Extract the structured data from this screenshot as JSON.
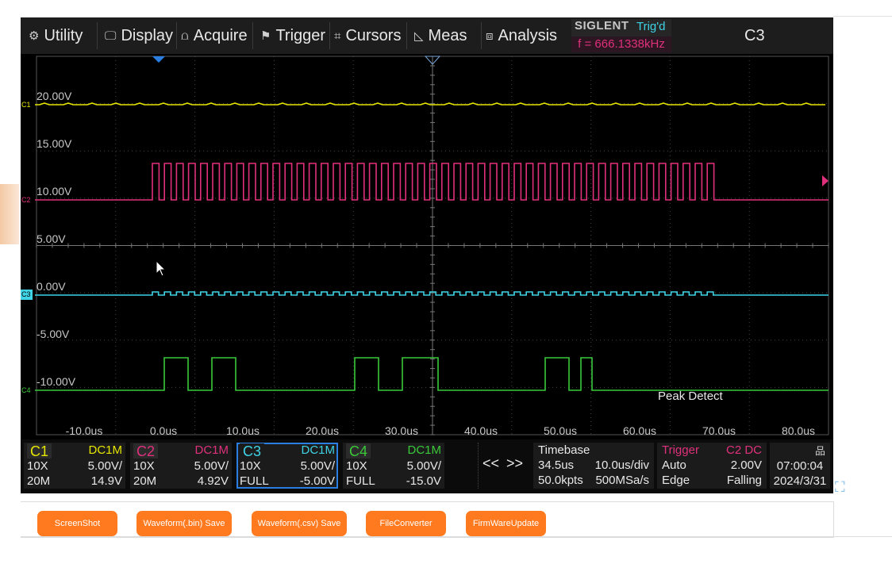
{
  "menu": {
    "utility": "Utility",
    "display": "Display",
    "acquire": "Acquire",
    "trigger": "Trigger",
    "cursors": "Cursors",
    "meas": "Meas",
    "analysis": "Analysis"
  },
  "brand": {
    "name": "SIGLENT",
    "trigger_state": "Trig'd",
    "frequency": "f = 666.1338kHz"
  },
  "selected_channel": "C3",
  "display": {
    "voltage_labels": [
      "20.00V",
      "15.00V",
      "10.00V",
      "5.00V",
      "0.00V",
      "-5.00V",
      "-10.00V"
    ],
    "time_labels": [
      "-10.0us",
      "0.0us",
      "10.0us",
      "20.0us",
      "30.0us",
      "40.0us",
      "50.0us",
      "60.0us",
      "70.0us",
      "80.0us"
    ],
    "acquire_mode": "Peak Detect",
    "channel_markers": [
      "C1",
      "C2",
      "C3",
      "C4"
    ]
  },
  "channels": [
    {
      "name": "C1",
      "coupling": "DC1M",
      "probe": "10X",
      "scale": "5.00V/",
      "bandwidth": "20M",
      "offset": "14.9V",
      "color": "#e6e600"
    },
    {
      "name": "C2",
      "coupling": "DC1M",
      "probe": "10X",
      "scale": "5.00V/",
      "bandwidth": "20M",
      "offset": "4.92V",
      "color": "#e0307c"
    },
    {
      "name": "C3",
      "coupling": "DC1M",
      "probe": "10X",
      "scale": "5.00V/",
      "bandwidth": "FULL",
      "offset": "-5.00V",
      "color": "#3fd3e6"
    },
    {
      "name": "C4",
      "coupling": "DC1M",
      "probe": "10X",
      "scale": "5.00V/",
      "bandwidth": "FULL",
      "offset": "-15.0V",
      "color": "#39c939"
    }
  ],
  "nav": {
    "prev": "<<",
    "next": ">>"
  },
  "timebase": {
    "title": "Timebase",
    "delay": "34.5us",
    "scale": "10.0us/div",
    "points": "50.0kpts",
    "sample_rate": "500MSa/s"
  },
  "trigger": {
    "title": "Trigger",
    "source": "C2 DC",
    "mode": "Auto",
    "level": "2.00V",
    "type": "Edge",
    "slope": "Falling"
  },
  "datetime": {
    "time": "07:00:04",
    "date": "2024/3/31"
  },
  "buttons": {
    "screenshot": "ScreenShot",
    "wave_bin": "Waveform(.bin) Save",
    "wave_csv": "Waveform(.csv) Save",
    "converter": "FileConverter",
    "firmware": "FirmWareUpdate"
  },
  "colors": {
    "ch1": "#e6e600",
    "ch2": "#e0307c",
    "ch3": "#3fd3e6",
    "ch4": "#39c939",
    "button": "#ff7a1f",
    "trigger_marker": "#2a7de1"
  }
}
